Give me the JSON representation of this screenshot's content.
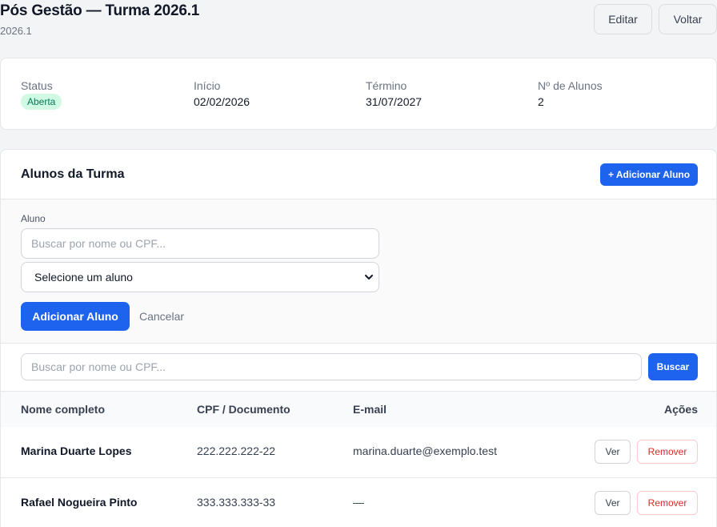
{
  "header": {
    "title": "Pós Gestão — Turma 2026.1",
    "subtitle": "2026.1",
    "edit_label": "Editar",
    "back_label": "Voltar"
  },
  "summary": {
    "status_label": "Status",
    "status_value": "Aberta",
    "start_label": "Início",
    "start_value": "02/02/2026",
    "end_label": "Término",
    "end_value": "31/07/2027",
    "count_label": "Nº de Alunos",
    "count_value": "2"
  },
  "students": {
    "title": "Alunos da Turma",
    "add_button": "+ Adicionar Aluno",
    "panel": {
      "field_label": "Aluno",
      "search_placeholder": "Buscar por nome ou CPF...",
      "select_value": "Selecione um aluno",
      "submit": "Adicionar Aluno",
      "cancel": "Cancelar"
    },
    "search": {
      "placeholder": "Buscar por nome ou CPF...",
      "button": "Buscar"
    },
    "columns": [
      "Nome completo",
      "CPF / Documento",
      "E-mail",
      "Ações"
    ],
    "rows": [
      {
        "name": "Marina Duarte Lopes",
        "cpf": "222.222.222-22",
        "email": "marina.duarte@exemplo.test",
        "view": "Ver",
        "remove": "Remover"
      },
      {
        "name": "Rafael Nogueira Pinto",
        "cpf": "333.333.333-33",
        "email": "—",
        "view": "Ver",
        "remove": "Remover"
      }
    ]
  },
  "colors": {
    "primary": "#1d63ed",
    "status_bg": "#d1fae5",
    "status_text": "#047857",
    "danger": "#dc2626"
  },
  "icons": {
    "select_caret": "chevron-down-icon"
  }
}
